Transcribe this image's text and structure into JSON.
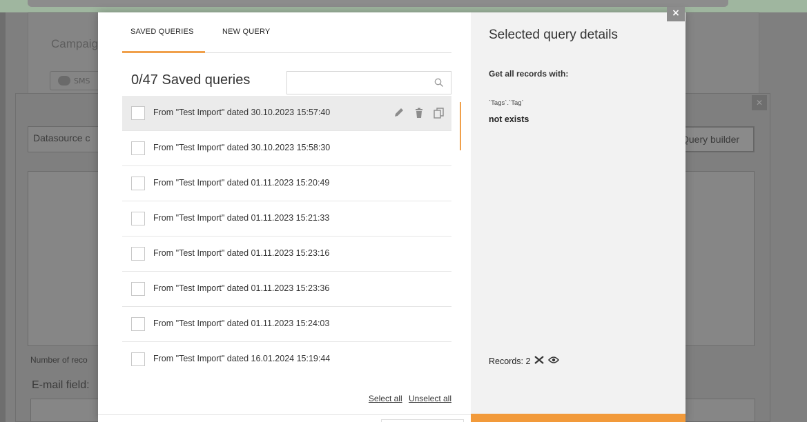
{
  "background": {
    "campaign_label": "Campaig",
    "sms_label": "SMS",
    "datasource_label": "Datasource c",
    "query_builder_label": "Query builder",
    "number_of_records_label": "Number of reco",
    "email_field_label": "E-mail field:"
  },
  "modal": {
    "close_label": "×",
    "tabs": [
      {
        "label": "SAVED QUERIES",
        "active": true
      },
      {
        "label": "NEW QUERY",
        "active": false
      }
    ],
    "saved_count_title": "0/47 Saved queries",
    "search": {
      "placeholder": "",
      "value": ""
    },
    "queries": [
      {
        "label": "From \"Test Import\" dated 30.10.2023 15:57:40",
        "active": true
      },
      {
        "label": "From \"Test Import\" dated 30.10.2023 15:58:30",
        "active": false
      },
      {
        "label": "From \"Test Import\" dated 01.11.2023 15:20:49",
        "active": false
      },
      {
        "label": "From \"Test Import\" dated 01.11.2023 15:21:33",
        "active": false
      },
      {
        "label": "From \"Test Import\" dated 01.11.2023 15:23:16",
        "active": false
      },
      {
        "label": "From \"Test Import\" dated 01.11.2023 15:23:36",
        "active": false
      },
      {
        "label": "From \"Test Import\" dated 01.11.2023 15:24:03",
        "active": false
      },
      {
        "label": "From \"Test Import\" dated 16.01.2024 15:19:44",
        "active": false
      }
    ],
    "row_actions": [
      "pencil-icon",
      "trash-icon",
      "copy-icon"
    ],
    "select_all_label": "Select all",
    "unselect_all_label": "Unselect all",
    "details": {
      "title": "Selected query details",
      "get_all_label": "Get all records with:",
      "field": "`Tags`.`Tag`",
      "condition": "not exists",
      "records_label": "Records: 2"
    },
    "colors": {
      "accent": "#f0a04b",
      "accent_button": "#f29a3a",
      "details_bg": "#f2f2f2",
      "active_row": "#ebebeb"
    }
  }
}
